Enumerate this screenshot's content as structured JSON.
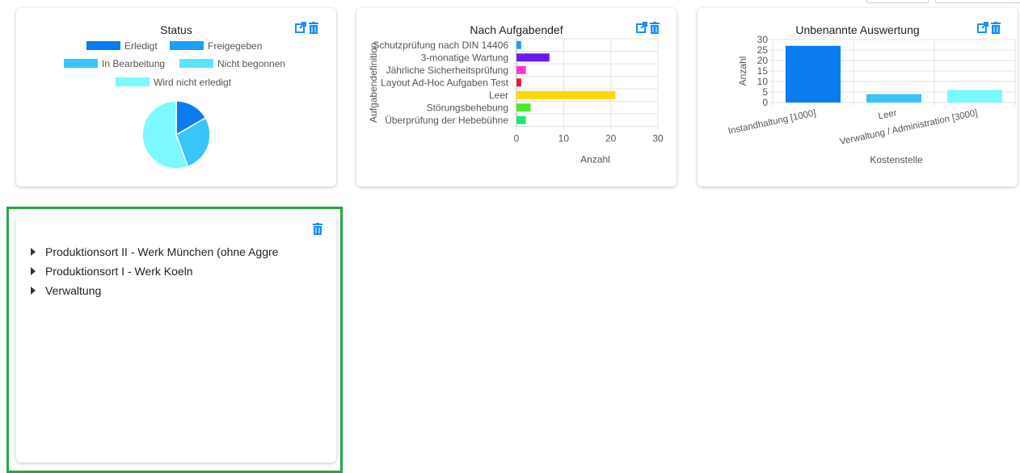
{
  "colors": {
    "accent": "#1a8cff",
    "selected_border": "#21a845",
    "erledigt": "#0a7cf0",
    "freigegeben": "#1e9ef5",
    "in_bearbeitung": "#37c6f7",
    "nicht_begonnen": "#5ae6fa",
    "wird_nicht_erledigt": "#7cf8ff"
  },
  "widgets": {
    "status": {
      "title": "Status",
      "icons": [
        "external-link-icon",
        "trash-icon"
      ],
      "chart_data": {
        "type": "pie",
        "title": "Status",
        "legend_position": "top",
        "slices": [
          {
            "name": "Erledigt",
            "value": 6,
            "color": "#0a7cf0"
          },
          {
            "name": "Freigegeben",
            "value": 0,
            "color": "#1e9ef5"
          },
          {
            "name": "In Bearbeitung",
            "value": 10,
            "color": "#37c6f7"
          },
          {
            "name": "Nicht begonnen",
            "value": 0,
            "color": "#5ae6fa"
          },
          {
            "name": "Wird nicht erledigt",
            "value": 20,
            "color": "#7cf8ff"
          }
        ]
      }
    },
    "aufgabendef": {
      "title": "Nach Aufgabendef",
      "icons": [
        "external-link-icon",
        "trash-icon"
      ],
      "chart_data": {
        "type": "bar",
        "orientation": "horizontal",
        "title": "Nach Aufgabendef",
        "xlabel": "Anzahl",
        "ylabel": "Aufgabendefinition",
        "xlim": [
          0,
          30
        ],
        "xticks": [
          0,
          10,
          20,
          30
        ],
        "grid": true,
        "categories": [
          "Schutzprüfung nach DIN 14406",
          "3-monatige Wartung",
          "Jährliche Sicherheitsprüfung",
          "Layout Ad-Hoc Aufgaben Test",
          "Leer",
          "Störungsbehebung",
          "Überprüfung der Hebebühne"
        ],
        "values": [
          1,
          7,
          2,
          1,
          21,
          3,
          2
        ],
        "colors": [
          "#1e9ef5",
          "#6a1bf0",
          "#f53bd0",
          "#f5142e",
          "#ffd700",
          "#49e82a",
          "#1ee87a"
        ]
      }
    },
    "unbenannt": {
      "title": "Unbenannte Auswertung",
      "icons": [
        "external-link-icon",
        "trash-icon"
      ],
      "chart_data": {
        "type": "bar",
        "title": "Unbenannte Auswertung",
        "xlabel": "Kostenstelle",
        "ylabel": "Anzahl",
        "ylim": [
          0,
          30
        ],
        "yticks": [
          0,
          5,
          10,
          15,
          20,
          25,
          30
        ],
        "grid": true,
        "categories": [
          "Instandhaltung [1000]",
          "Leer",
          "Verwaltung / Administration [3000]"
        ],
        "values": [
          27,
          4,
          6
        ],
        "colors": [
          "#0a7cf0",
          "#37c6f7",
          "#7cf8ff"
        ]
      }
    },
    "tree": {
      "icons": [
        "trash-icon"
      ],
      "items": [
        {
          "label": "Produktionsort II - Werk München (ohne Aggre"
        },
        {
          "label": "Produktionsort I - Werk Koeln"
        },
        {
          "label": "Verwaltung"
        }
      ]
    }
  }
}
